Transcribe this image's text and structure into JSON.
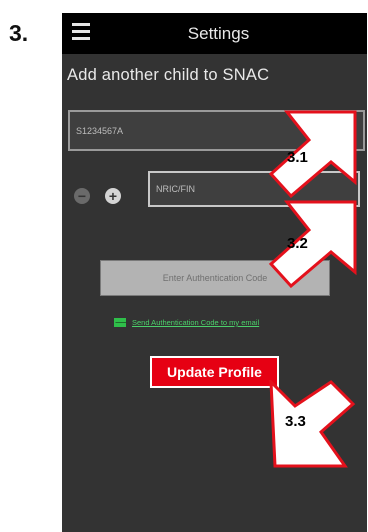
{
  "step_number": "3.",
  "topbar": {
    "title": "Settings",
    "menu_icon": "hamburger-menu-icon"
  },
  "page": {
    "subheading": "Add another child to SNAC"
  },
  "form": {
    "id_field_value": "S1234567A",
    "nric_placeholder": "NRIC/FIN",
    "minus_icon": "minus-circle-icon",
    "plus_icon": "plus-circle-icon",
    "auth_button_label": "Enter Authentication Code",
    "email_icon": "email-icon",
    "email_link_label": "Send Authentication Code to my email",
    "update_button_label": "Update Profile"
  },
  "callouts": {
    "c1": "3.1",
    "c2": "3.2",
    "c3": "3.3"
  },
  "colors": {
    "callout_border": "#e4111c",
    "update_button": "#e60013",
    "email_link": "#4bd06a"
  }
}
